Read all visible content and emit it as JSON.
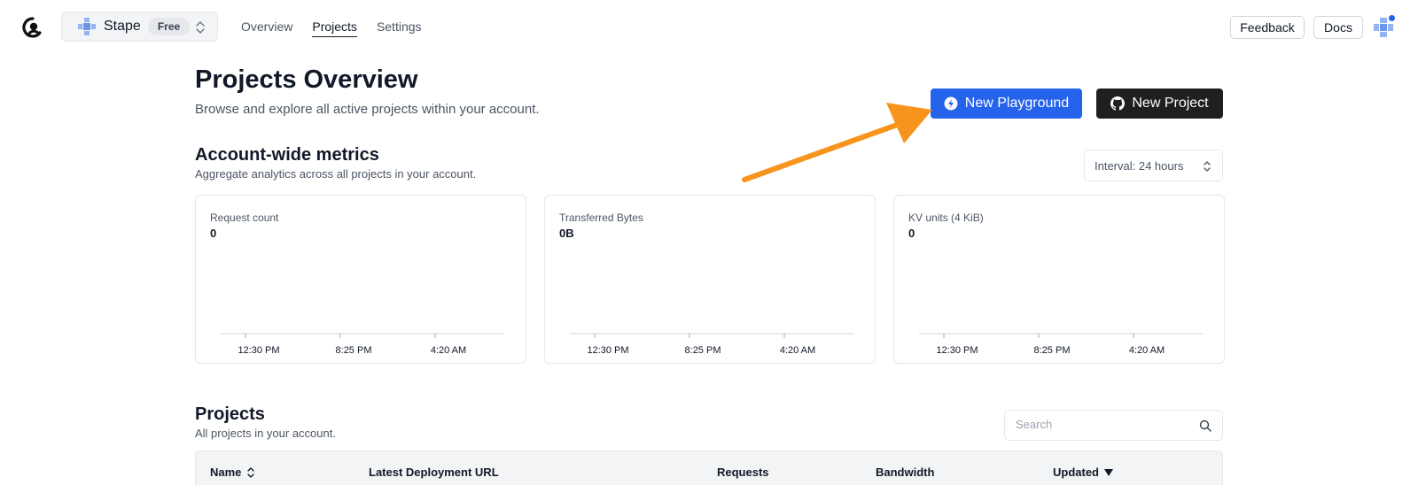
{
  "header": {
    "org_name": "Stape",
    "plan_badge": "Free",
    "nav": [
      "Overview",
      "Projects",
      "Settings"
    ],
    "active_nav": "Projects",
    "feedback_label": "Feedback",
    "docs_label": "Docs"
  },
  "page": {
    "title": "Projects Overview",
    "subtitle": "Browse and explore all active projects within your account.",
    "new_playground_label": "New Playground",
    "new_project_label": "New Project"
  },
  "metrics": {
    "title": "Account-wide metrics",
    "subtitle": "Aggregate analytics across all projects in your account.",
    "interval_label": "Interval: 24 hours",
    "cards": [
      {
        "label": "Request count",
        "value": "0",
        "ticks": [
          "12:30 PM",
          "8:25 PM",
          "4:20 AM"
        ]
      },
      {
        "label": "Transferred Bytes",
        "value": "0B",
        "ticks": [
          "12:30 PM",
          "8:25 PM",
          "4:20 AM"
        ]
      },
      {
        "label": "KV units (4 KiB)",
        "value": "0",
        "ticks": [
          "12:30 PM",
          "8:25 PM",
          "4:20 AM"
        ]
      }
    ]
  },
  "projects": {
    "title": "Projects",
    "subtitle": "All projects in your account.",
    "search_placeholder": "Search",
    "columns": [
      "Name",
      "Latest Deployment URL",
      "Requests",
      "Bandwidth",
      "Updated"
    ]
  },
  "colors": {
    "primary": "#2563eb",
    "dark_button": "#1f1f1f",
    "annotation_arrow": "#f7941d"
  }
}
